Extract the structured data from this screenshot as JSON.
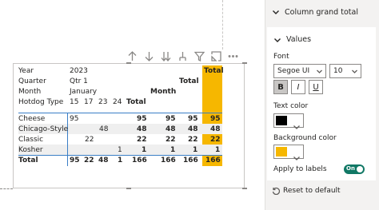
{
  "toolbar": {
    "icons": [
      "pin-icon",
      "drill-down-icon",
      "drill-down-all-icon",
      "expand-icon",
      "filter-icon",
      "focus-mode-icon",
      "more-options-icon"
    ]
  },
  "matrix": {
    "header_labels": [
      "Year",
      "Quarter",
      "Month",
      "Hotdog Type"
    ],
    "year": "2023",
    "quarter": "Qtr 1",
    "month": "January",
    "days": [
      "15",
      "17",
      "23",
      "24"
    ],
    "total_label": "Total",
    "month_label": "Month",
    "total_col_label": "Total",
    "rows": [
      {
        "name": "Cheese",
        "d15": "95",
        "d17": "",
        "d23": "",
        "d24": "",
        "total": "95",
        "m1": "95",
        "m2": "95",
        "grand": "95"
      },
      {
        "name": "Chicago-Style",
        "d15": "",
        "d17": "",
        "d23": "48",
        "d24": "",
        "total": "48",
        "m1": "48",
        "m2": "48",
        "grand": "48"
      },
      {
        "name": "Classic",
        "d15": "",
        "d17": "22",
        "d23": "",
        "d24": "",
        "total": "22",
        "m1": "22",
        "m2": "22",
        "grand": "22"
      },
      {
        "name": "Kosher",
        "d15": "",
        "d17": "",
        "d23": "",
        "d24": "1",
        "total": "1",
        "m1": "1",
        "m2": "1",
        "grand": "1"
      }
    ],
    "totals_row": {
      "name": "Total",
      "d15": "95",
      "d17": "22",
      "d23": "48",
      "d24": "1",
      "total": "166",
      "m1": "166",
      "m2": "166",
      "grand": "166"
    },
    "highlight_color": "#f6b700"
  },
  "pane": {
    "section_title": "Column grand total",
    "values_title": "Values",
    "font_label": "Font",
    "font_family": "Segoe UI",
    "font_size": "10",
    "bold": "B",
    "italic": "I",
    "underline": "U",
    "text_color_label": "Text color",
    "text_color": "#000000",
    "background_color_label": "Background color",
    "background_color": "#f6b700",
    "apply_labels_label": "Apply to labels",
    "apply_labels_state": "On",
    "reset_label": "Reset to default"
  }
}
